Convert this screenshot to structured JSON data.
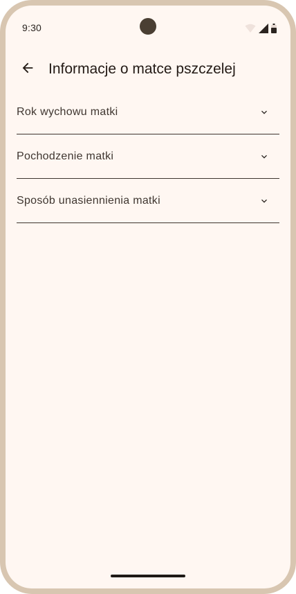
{
  "status_bar": {
    "time": "9:30",
    "icons": [
      "wifi-icon",
      "cellular-signal-icon",
      "battery-icon"
    ]
  },
  "app_bar": {
    "back_icon": "arrow-back-icon",
    "title": "Informacje o matce pszczelej"
  },
  "sections": [
    {
      "label": "Rok wychowu matki",
      "icon": "chevron-down-icon"
    },
    {
      "label": "Pochodzenie matki",
      "icon": "chevron-down-icon"
    },
    {
      "label": "Sposób unasiennienia matki",
      "icon": "chevron-down-icon"
    }
  ],
  "colors": {
    "frame": "#d8c6b1",
    "background": "#fff7f2",
    "text_primary": "#231a15",
    "text_secondary": "#3f3630",
    "divider": "#3d342e"
  }
}
